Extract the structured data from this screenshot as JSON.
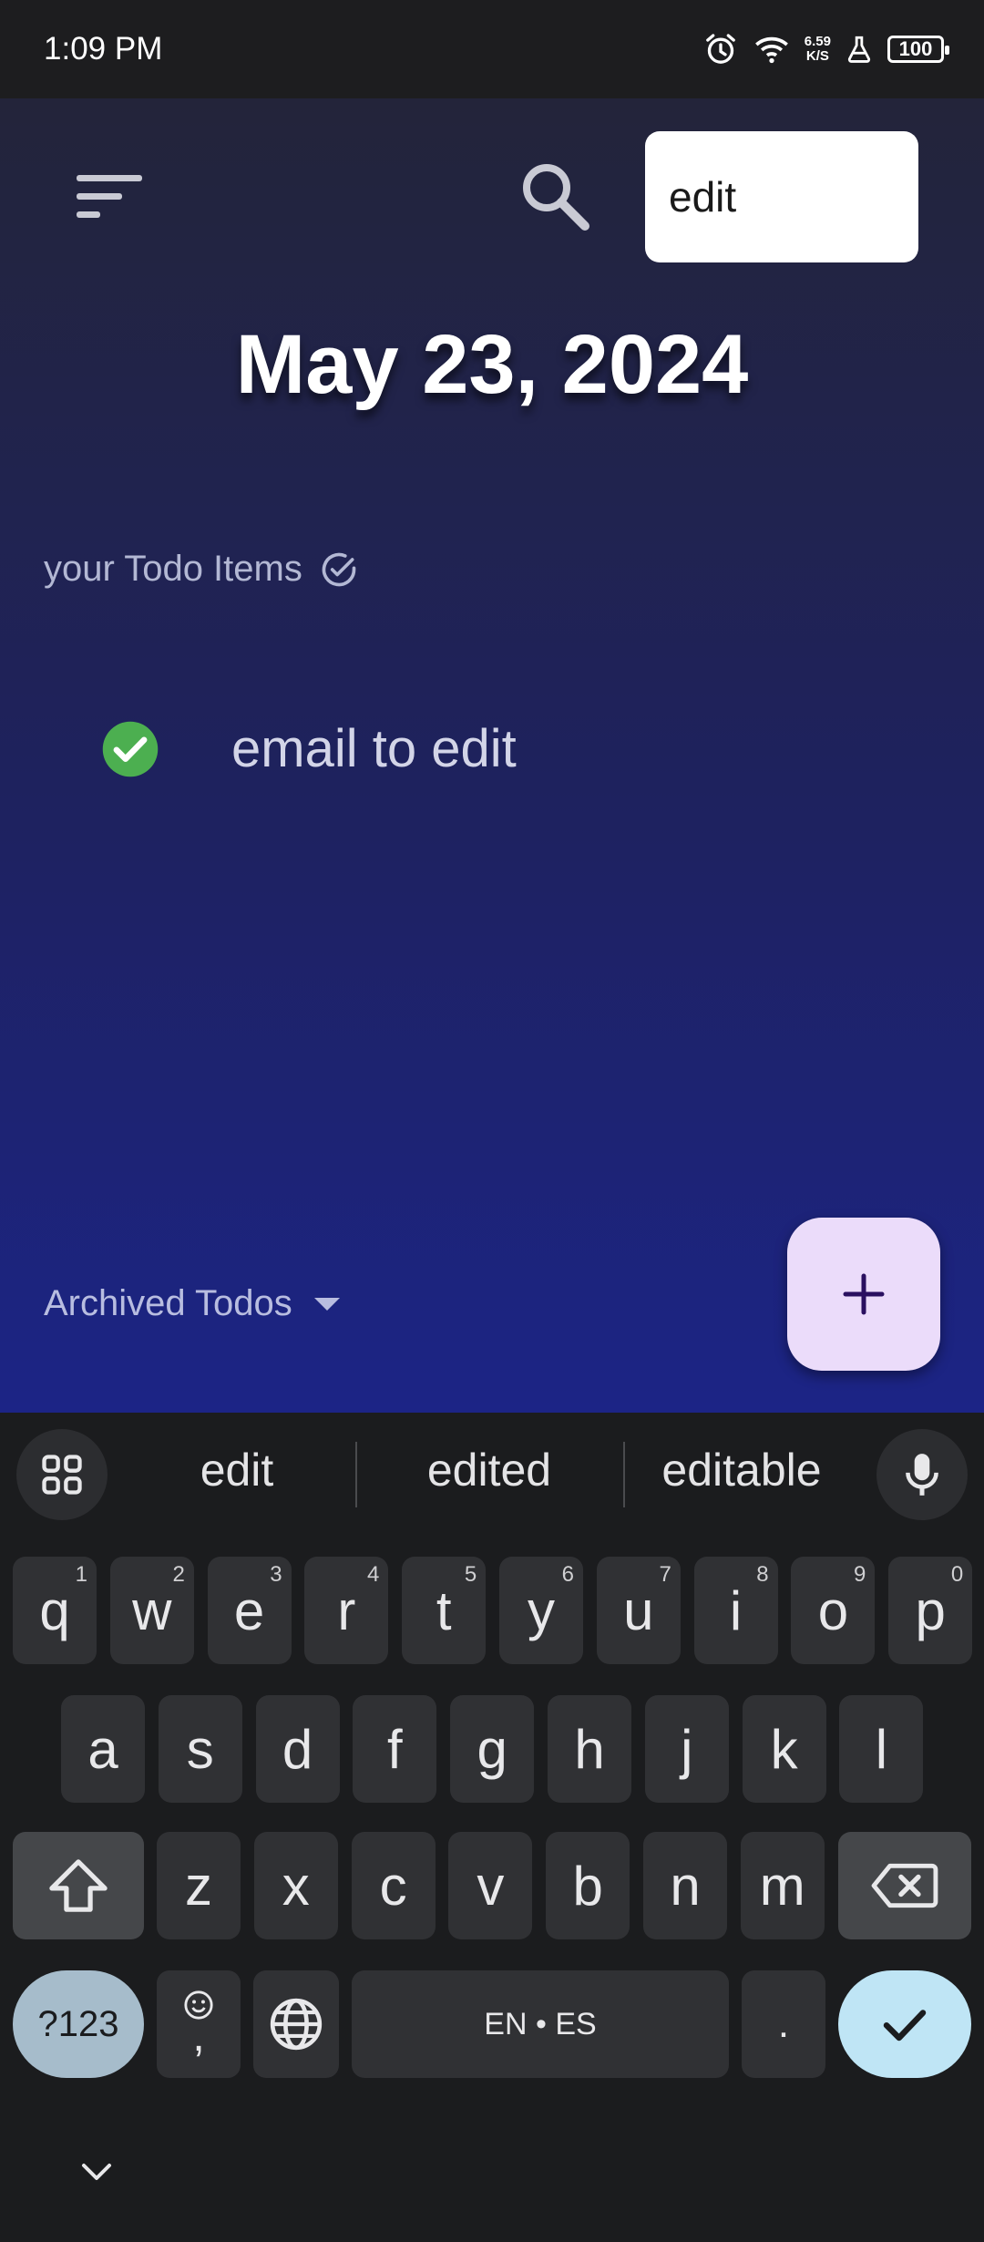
{
  "status_bar": {
    "time": "1:09 PM",
    "net_speed_value": "6.59",
    "net_speed_unit": "K/S",
    "battery": "100",
    "icons": [
      "alarm-icon",
      "wifi-icon",
      "lab-icon",
      "battery-icon"
    ]
  },
  "app": {
    "search_value": "edit",
    "date_title": "May 23, 2024",
    "section_label": "your Todo Items",
    "todos": [
      {
        "text": "email to edit",
        "done": true
      }
    ],
    "archived_label": "Archived Todos",
    "fab_icon": "plus-icon",
    "colors": {
      "bg_top": "#23243a",
      "bg_bottom": "#1c2486",
      "check_green": "#4caf50",
      "fab_bg": "#ebdcfa",
      "fab_icon": "#2a1060"
    }
  },
  "keyboard": {
    "suggestions": [
      "edit",
      "edited",
      "editable"
    ],
    "row1": [
      {
        "k": "q",
        "h": "1"
      },
      {
        "k": "w",
        "h": "2"
      },
      {
        "k": "e",
        "h": "3"
      },
      {
        "k": "r",
        "h": "4"
      },
      {
        "k": "t",
        "h": "5"
      },
      {
        "k": "y",
        "h": "6"
      },
      {
        "k": "u",
        "h": "7"
      },
      {
        "k": "i",
        "h": "8"
      },
      {
        "k": "o",
        "h": "9"
      },
      {
        "k": "p",
        "h": "0"
      }
    ],
    "row2": [
      "a",
      "s",
      "d",
      "f",
      "g",
      "h",
      "j",
      "k",
      "l"
    ],
    "row3": [
      "z",
      "x",
      "c",
      "v",
      "b",
      "n",
      "m"
    ],
    "symbols_label": "?123",
    "comma": ",",
    "space_label": "EN • ES",
    "period": ".",
    "colors": {
      "symbols_key": "#a6bccb",
      "enter_key": "#bfe5f5"
    }
  }
}
